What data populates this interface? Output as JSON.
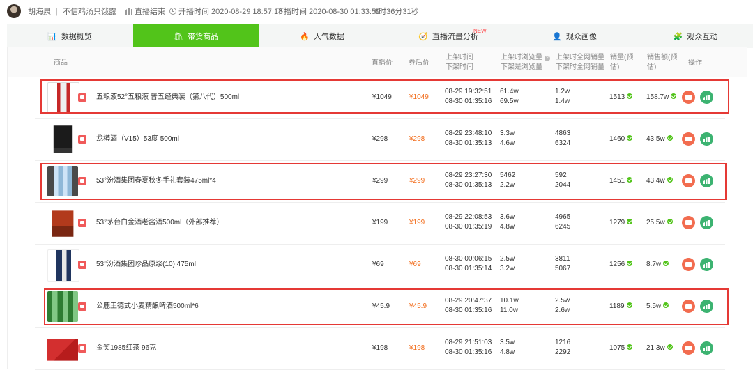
{
  "topbar": {
    "anchor_name": "胡海泉",
    "anchor_tag": "不信鸡汤只饿露",
    "live_status": "直播结束",
    "start_time": "开播时间 2020-08-29 18:57:18",
    "end_time": "下播时间 2020-08-30 01:33:50",
    "duration": "6时36分31秒"
  },
  "tabs": [
    {
      "label": "数据概览",
      "icon": "bar-chart-icon",
      "active": false
    },
    {
      "label": "带货商品",
      "icon": "shopping-bag-icon",
      "active": true
    },
    {
      "label": "人气数据",
      "icon": "flame-icon",
      "active": false
    },
    {
      "label": "直播流量分析",
      "icon": "compass-icon",
      "active": false,
      "badge": "NEW"
    },
    {
      "label": "观众画像",
      "icon": "portrait-icon",
      "active": false
    },
    {
      "label": "观众互动",
      "icon": "puzzle-icon",
      "active": false
    }
  ],
  "table": {
    "headers": {
      "product": "商品",
      "live_price": "直播价",
      "coupon_price": "券后价",
      "list_time_1": "上架时间",
      "list_time_2": "下架时间",
      "views_1": "上架时浏览量",
      "views_2": "下架是浏览量",
      "sales_all_1": "上架时全网销量",
      "sales_all_2": "下架时全网销量",
      "sales_est_1": "销量(预",
      "sales_est_2": "估)",
      "revenue_1": "销售额(预",
      "revenue_2": "估)",
      "action": "操作"
    },
    "rows": [
      {
        "name": "五粮液52°五粮液 普五经典装（第八代）500ml",
        "live_price": "¥1049",
        "coupon_price": "¥1049",
        "on_time": "08-29 19:32:51",
        "off_time": "08-30 01:35:16",
        "views_on": "61.4w",
        "views_off": "69.5w",
        "sales_on": "1.2w",
        "sales_off": "1.4w",
        "sales_est": "1513",
        "revenue": "158.7w",
        "highlighted": true
      },
      {
        "name": "龙樽酒（V15）53度 500ml",
        "live_price": "¥298",
        "coupon_price": "¥298",
        "on_time": "08-29 23:48:10",
        "off_time": "08-30 01:35:13",
        "views_on": "3.3w",
        "views_off": "4.6w",
        "sales_on": "4863",
        "sales_off": "6324",
        "sales_est": "1460",
        "revenue": "43.5w",
        "highlighted": false
      },
      {
        "name": "53°汾酒集团春夏秋冬手礼套装475ml*4",
        "live_price": "¥299",
        "coupon_price": "¥299",
        "on_time": "08-29 23:27:30",
        "off_time": "08-30 01:35:13",
        "views_on": "5462",
        "views_off": "2.2w",
        "sales_on": "592",
        "sales_off": "2044",
        "sales_est": "1451",
        "revenue": "43.4w",
        "highlighted": true
      },
      {
        "name": "53°茅台白金酒老酱酒500ml（外部推荐）",
        "live_price": "¥199",
        "coupon_price": "¥199",
        "on_time": "08-29 22:08:53",
        "off_time": "08-30 01:35:19",
        "views_on": "3.6w",
        "views_off": "4.8w",
        "sales_on": "4965",
        "sales_off": "6245",
        "sales_est": "1279",
        "revenue": "25.5w",
        "highlighted": false
      },
      {
        "name": "53°汾酒集团珍品原浆(10) 475ml",
        "live_price": "¥69",
        "coupon_price": "¥69",
        "on_time": "08-30 00:06:15",
        "off_time": "08-30 01:35:14",
        "views_on": "2.5w",
        "views_off": "3.2w",
        "sales_on": "3811",
        "sales_off": "5067",
        "sales_est": "1256",
        "revenue": "8.7w",
        "highlighted": false
      },
      {
        "name": "公鹿王德式小麦精酿啤酒500ml*6",
        "live_price": "¥45.9",
        "coupon_price": "¥45.9",
        "on_time": "08-29 20:47:37",
        "off_time": "08-30 01:35:16",
        "views_on": "10.1w",
        "views_off": "11.0w",
        "sales_on": "2.5w",
        "sales_off": "2.6w",
        "sales_est": "1189",
        "revenue": "5.5w",
        "highlighted": true
      },
      {
        "name": "金奖1985红茶 96克",
        "live_price": "¥198",
        "coupon_price": "¥198",
        "on_time": "08-29 21:51:03",
        "off_time": "08-30 01:35:16",
        "views_on": "3.5w",
        "views_off": "4.8w",
        "sales_on": "1216",
        "sales_off": "2292",
        "sales_est": "1075",
        "revenue": "21.3w",
        "highlighted": false
      }
    ]
  },
  "colors": {
    "accent": "#52c41a",
    "highlight": "#e53935",
    "price": "#f26c1b"
  }
}
